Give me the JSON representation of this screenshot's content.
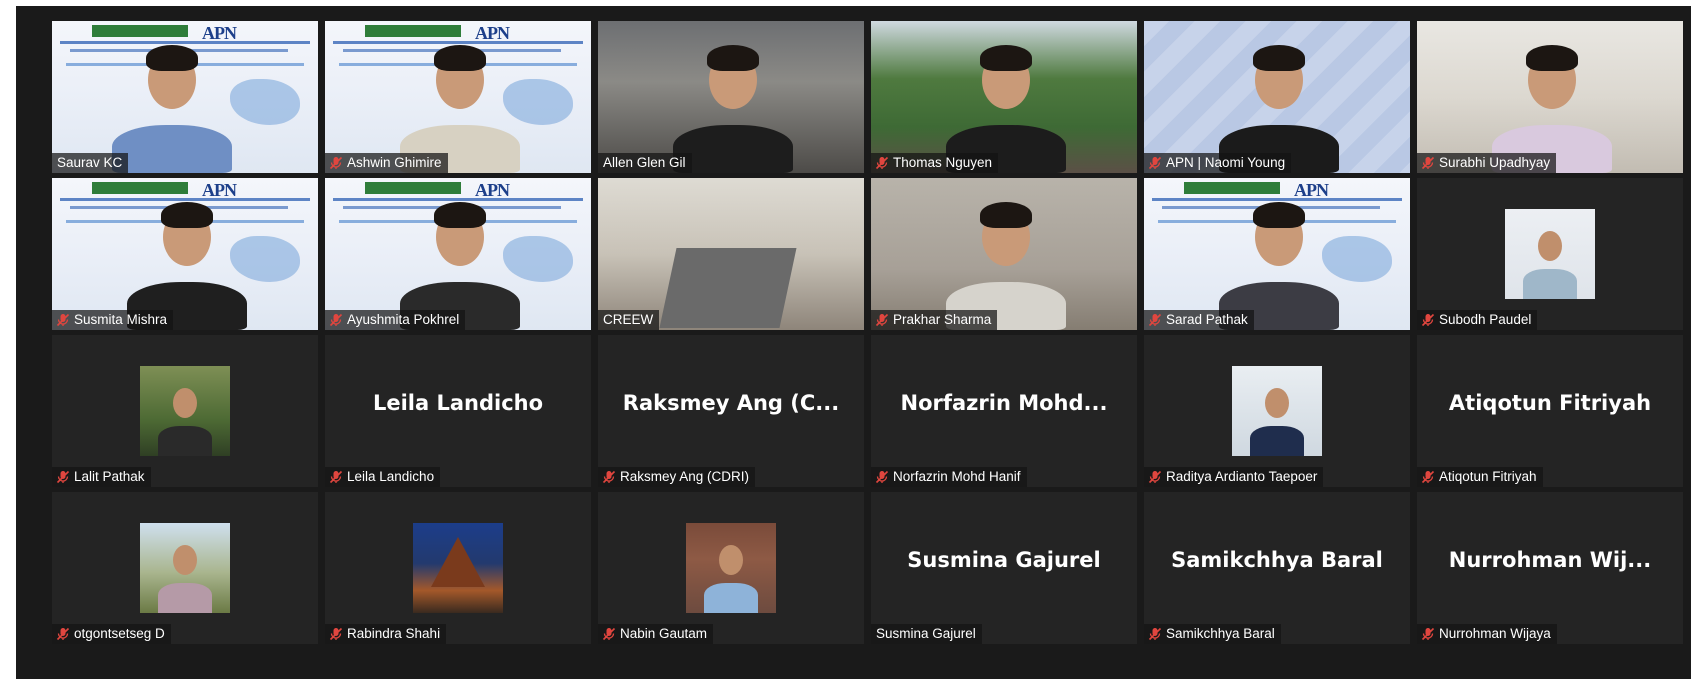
{
  "colors": {
    "background": "#1a1a1a",
    "tile": "#242424",
    "active_speaker_border": "#d8e07a",
    "muted_icon": "#e0463f"
  },
  "slide": {
    "apn_mark": "APN"
  },
  "participants": [
    {
      "name": "Saurav KC",
      "muted": false,
      "video": "slide"
    },
    {
      "name": "Ashwin Ghimire",
      "muted": true,
      "video": "slide"
    },
    {
      "name": "Allen Glen Gil",
      "muted": false,
      "video": "office",
      "active": true
    },
    {
      "name": "Thomas Nguyen",
      "muted": true,
      "video": "arch"
    },
    {
      "name": "APN | Naomi Young",
      "muted": true,
      "video": "apn"
    },
    {
      "name": "Surabhi Upadhyay",
      "muted": true,
      "video": "room"
    },
    {
      "name": "Susmita Mishra",
      "muted": true,
      "video": "slide"
    },
    {
      "name": "Ayushmita Pokhrel",
      "muted": true,
      "video": "slide"
    },
    {
      "name": "CREEW",
      "muted": false,
      "video": "conference"
    },
    {
      "name": "Prakhar Sharma",
      "muted": true,
      "video": "wall"
    },
    {
      "name": "Sarad Pathak",
      "muted": true,
      "video": "slide"
    },
    {
      "name": "Subodh Paudel",
      "muted": true,
      "video": "none",
      "avatar": "portrait"
    },
    {
      "name": "Lalit Pathak",
      "muted": true,
      "video": "none",
      "avatar": "forest"
    },
    {
      "name": "Leila Landicho",
      "muted": true,
      "video": "none",
      "display_name": "Leila Landicho"
    },
    {
      "name": "Raksmey Ang (CDRI)",
      "muted": true,
      "video": "none",
      "display_name": "Raksmey Ang (C..."
    },
    {
      "name": "Norfazrin Mohd Hanif",
      "muted": true,
      "video": "none",
      "display_name": "Norfazrin Mohd..."
    },
    {
      "name": "Raditya Ardianto Taepoer",
      "muted": true,
      "video": "none",
      "avatar": "navy"
    },
    {
      "name": "Atiqotun Fitriyah",
      "muted": true,
      "video": "none",
      "display_name": "Atiqotun Fitriyah"
    },
    {
      "name": "otgontsetseg D",
      "muted": true,
      "video": "none",
      "avatar": "hills"
    },
    {
      "name": "Rabindra Shahi",
      "muted": true,
      "video": "none",
      "avatar": "temple"
    },
    {
      "name": "Nabin Gautam",
      "muted": true,
      "video": "none",
      "avatar": "brick"
    },
    {
      "name": "Susmina Gajurel",
      "muted": false,
      "video": "none",
      "display_name": "Susmina Gajurel"
    },
    {
      "name": "Samikchhya Baral",
      "muted": true,
      "video": "none",
      "display_name": "Samikchhya Baral"
    },
    {
      "name": "Nurrohman Wijaya",
      "muted": true,
      "video": "none",
      "display_name": "Nurrohman Wij..."
    }
  ]
}
